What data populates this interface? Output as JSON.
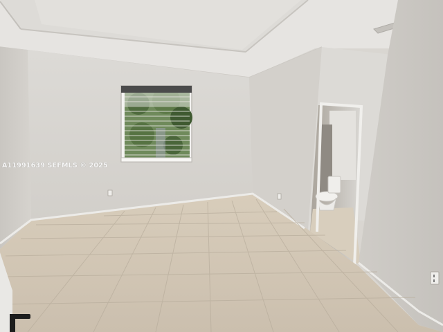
{
  "photo": {
    "watermark": "A11991639 SEFMLS © 2025"
  }
}
